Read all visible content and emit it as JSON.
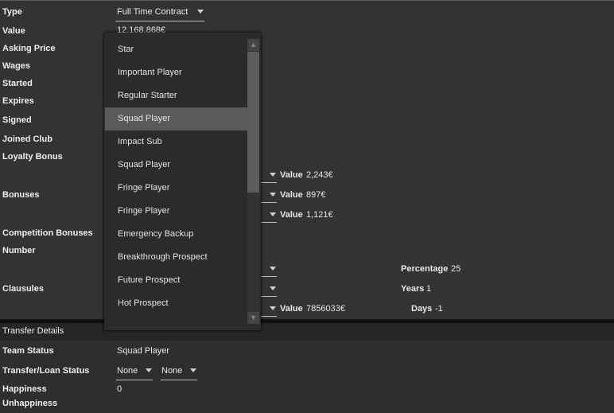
{
  "form": {
    "type_label": "Type",
    "type_value": "Full Time Contract",
    "value_label": "Value",
    "value_value": "12,168,868€",
    "asking_price_label": "Asking Price",
    "wages_label": "Wages",
    "started_label": "Started",
    "expires_label": "Expires",
    "signed_label": "Signed",
    "joined_club_label": "Joined Club",
    "loyalty_bonus_label": "Loyalty Bonus",
    "bonuses_label": "Bonuses",
    "competition_bonuses_label": "Competition Bonuses",
    "number_label": "Number",
    "clausules_label": "Clausules"
  },
  "bonuses": [
    {
      "value_label": "Value",
      "value": "2,243€"
    },
    {
      "value_label": "Value",
      "value": "897€"
    },
    {
      "value_label": "Value",
      "value": "1,121€"
    }
  ],
  "clausules": {
    "percentage_label": "Percentage",
    "percentage_value": "25",
    "years_label": "Years",
    "years_value": "1",
    "value_label": "Value",
    "value_value": "7856033€",
    "days_label": "Days",
    "days_value": "-1"
  },
  "transfer": {
    "section_title": "Transfer Details",
    "team_status_label": "Team Status",
    "team_status_value": "Squad Player",
    "transfer_loan_label": "Transfer/Loan Status",
    "transfer_value": "None",
    "loan_value": "None",
    "happiness_label": "Happiness",
    "happiness_value": "0",
    "unhappiness_label": "Unhappiness"
  },
  "dropdown": {
    "options": [
      "Star",
      "Important Player",
      "Regular Starter",
      "Squad Player",
      "Impact Sub",
      "Squad Player",
      "Fringe Player",
      "Fringe Player",
      "Emergency Backup",
      "Breakthrough Prospect",
      "Future Prospect",
      "Hot Prospect"
    ],
    "selected_index": 3,
    "scroll_up_icon": "arrow-up-icon",
    "scroll_down_icon": "arrow-down-icon"
  }
}
